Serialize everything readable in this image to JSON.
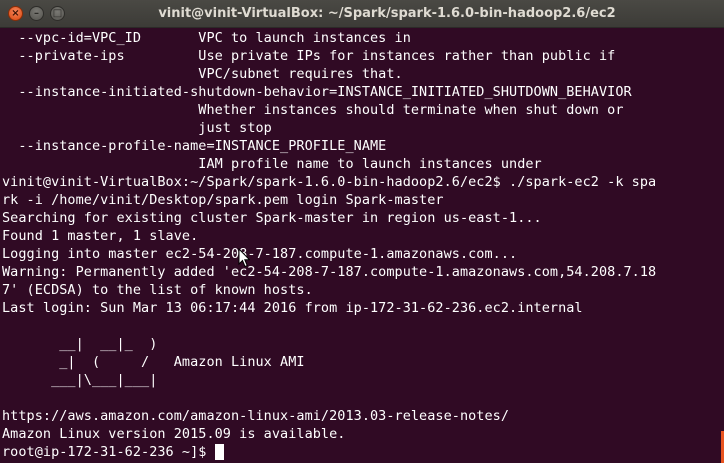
{
  "window": {
    "title": "vinit@vinit-VirtualBox: ~/Spark/spark-1.6.0-bin-hadoop2.6/ec2",
    "close_symbol": "×",
    "minimize_symbol": "–",
    "maximize_symbol": "□"
  },
  "terminal": {
    "lines": [
      "  --vpc-id=VPC_ID       VPC to launch instances in",
      "  --private-ips         Use private IPs for instances rather than public if",
      "                        VPC/subnet requires that.",
      "  --instance-initiated-shutdown-behavior=INSTANCE_INITIATED_SHUTDOWN_BEHAVIOR",
      "                        Whether instances should terminate when shut down or",
      "                        just stop",
      "  --instance-profile-name=INSTANCE_PROFILE_NAME",
      "                        IAM profile name to launch instances under",
      "vinit@vinit-VirtualBox:~/Spark/spark-1.6.0-bin-hadoop2.6/ec2$ ./spark-ec2 -k spa",
      "rk -i /home/vinit/Desktop/spark.pem login Spark-master",
      "Searching for existing cluster Spark-master in region us-east-1...",
      "Found 1 master, 1 slave.",
      "Logging into master ec2-54-208-7-187.compute-1.amazonaws.com...",
      "Warning: Permanently added 'ec2-54-208-7-187.compute-1.amazonaws.com,54.208.7.18",
      "7' (ECDSA) to the list of known hosts.",
      "Last login: Sun Mar 13 06:17:44 2016 from ip-172-31-62-236.ec2.internal",
      "",
      "       __|  __|_  )",
      "       _|  (     /   Amazon Linux AMI",
      "      ___|\\___|___|",
      "",
      "https://aws.amazon.com/amazon-linux-ami/2013.03-release-notes/",
      "Amazon Linux version 2015.09 is available."
    ],
    "prompt": "root@ip-172-31-62-236 ~]$"
  },
  "colors": {
    "background": "#300a24",
    "text": "#ffffff",
    "titlebar": "#3c3b37",
    "close_button": "#e95420"
  },
  "icons": {
    "close": "close-icon",
    "minimize": "minimize-icon",
    "maximize": "maximize-icon",
    "pointer": "mouse-pointer-icon"
  }
}
